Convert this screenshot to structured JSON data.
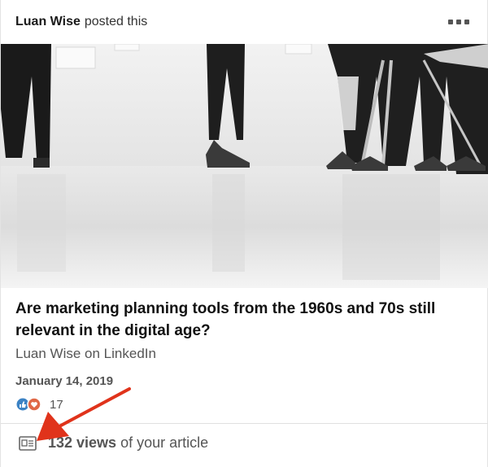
{
  "post": {
    "author": "Luan Wise",
    "action": "posted this",
    "more_icon": "ellipsis-icon"
  },
  "article": {
    "title": "Are marketing planning tools from the 1960s and 70s still relevant in the digital age?",
    "source": "Luan Wise on LinkedIn",
    "date": "January 14, 2019"
  },
  "reactions": {
    "icons": [
      "like-icon",
      "love-icon"
    ],
    "count": "17"
  },
  "stats": {
    "icon": "article-icon",
    "views_count": "132 views",
    "views_suffix": "of your article"
  },
  "colors": {
    "like": "#3b82c4",
    "love": "#e06847",
    "annotation_arrow": "#e0331b"
  }
}
